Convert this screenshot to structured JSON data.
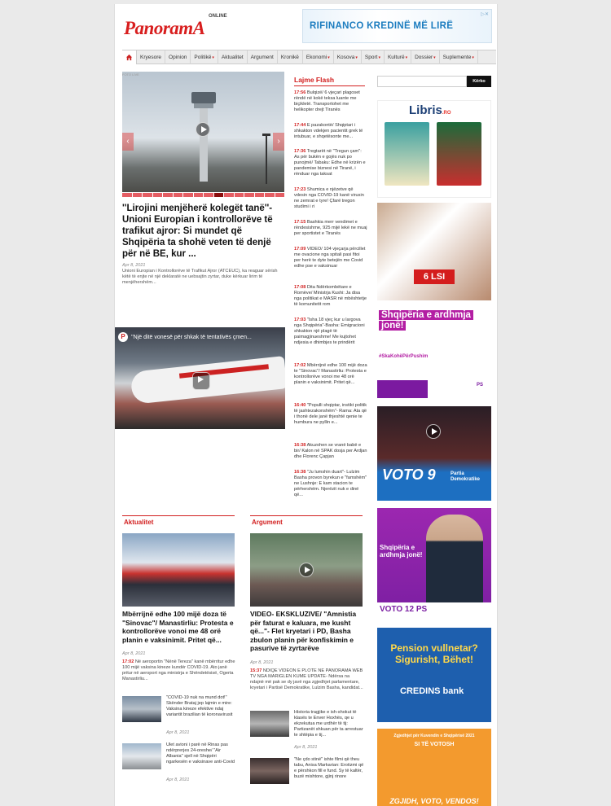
{
  "header": {
    "logo_text": "PanoramA",
    "logo_sub": "ONLINE",
    "ad_text": "RIFINANCO KREDINË MË LIRË"
  },
  "nav": {
    "items": [
      "Kryesore",
      "Opinion",
      "Politikë",
      "Aktualitet",
      "Argument",
      "Kronikë",
      "Ekonomi",
      "Kosova",
      "Sport",
      "Kulturë",
      "Dossier",
      "Suplemente"
    ]
  },
  "main": {
    "slider_tag": "FOTO LIVE",
    "headline": "''Lirojini menjëherë kolegët tanë''- Unioni Europian i kontrollorëve të trafikut ajror: Si mundet që Shqipëria ta shohë veten të denjë për në BE, kur ...",
    "date": "Apr 8, 2021",
    "lede": "Unioni Europian i Kontrollorëve të Trafikut Ajror (ATCEUC), ka reaguar sërish këtë të enjte në një deklaratë ne uebsajtin zyrtar, duke kërkuar lirim të menjëhershëm...",
    "video_title": "''Një ditë vonesë për shkak të tentativës çmen..."
  },
  "flash": {
    "title": "Lajme Flash",
    "items": [
      {
        "time": "17:56",
        "text": "Bulqizë/ 6 vjeçari plagoset rëndë në kokë teksa luante me biçikletë. Transportohet me helikopter drejt Tiranës"
      },
      {
        "time": "17:44",
        "text": "E pazakontë/ Shqiptari i shkakton vdekjen pacientit grek të intubuar, e shqetësonte me..."
      },
      {
        "time": "17:36",
        "text": "Tregtarët në \"Tregun çam\": As për bukën e gojës nuk po punojmë/ Tabaku: Edhe në krizën e pandemise biznesi në Tiranë, i rënduar nga taksat"
      },
      {
        "time": "17:23",
        "text": "Shumica e njëzetve që vdesin nga COVID-19 kanë virusin ne zemrat e tyre! Çfarë tregon studimi i ri"
      },
      {
        "time": "17:15",
        "text": "Bashkia merr vendimet e rëndesishme, 925 mijë lekë ne muaj per sportistet e Tiranës"
      },
      {
        "time": "17:09",
        "text": "VIDEO/ 104 vjeçarja përcillet me ovacione nga spitali pasi fitoi per herë te dyte betejën me Covid edhe pse e vaksinuar"
      },
      {
        "time": "17:08",
        "text": "Dita Ndërkombëtare e Romëve/ Ministrja Kushi: Ja disa nga politikat e MASR në mbështetje të komunitetit rom"
      },
      {
        "time": "17:03",
        "text": "\"Isha 18 vjeç kur u largova nga Shqipëria\"-Basha: Emigracioni shkakton një plagë të paimagjinueshme! Me kujtohet ndjesia e dhimbjes te prindërit"
      },
      {
        "time": "17:02",
        "text": "Mbërrijnë edhe 100 mijë doza te \"Sinovac\"/ Manastirliu: Protesta e kontrollorëve vonoi me 48 orë planin e vaksinimit. Pritet që..."
      },
      {
        "time": "16:40",
        "text": "\"Populli shqiptar, instikt politik të jashtezakonshëm\"- Rama: Ata që i thonë dele janë thjeshtë qenie te humbura ne pyllin e..."
      },
      {
        "time": "16:38",
        "text": "Akuzohen se vranë babë e bir/ Kalon në SPAK dosja per Ardjan dhe Florenc Çapjan"
      },
      {
        "time": "16:38",
        "text": "\"Ju lumshin duart\"- Lulzim Basha provon byrekun e \"famshëm\" ne Lushnje: E kam stacion te përhershëm. Njerëzit nuk e dinë që..."
      }
    ]
  },
  "sidebar": {
    "search_button": "Kërko",
    "ad1_brand": "Libris",
    "ad1_tld": ".RO",
    "ad2_text": "6 LSI",
    "ad3_title": "Shqipëria e ardhmja jonë!",
    "ad3_tag": "#SkaKohëPërPushim",
    "ad3_logo": "PS",
    "ad4_text": "VOTO 9",
    "ad4_party": "Partia Demokratike",
    "ad5_title": "Shqipëria e ardhmja jonë!",
    "ad5_footer": "VOTO 12 PS",
    "ad6_title": "Pension vullnetar? Sigurisht, Bëhet!",
    "ad6_bank": "CREDINS bank",
    "ad7_head": "Zgjedhjet për Kuvendin e Shqipërisë 2021",
    "ad7_title": "SI TË VOTOSH",
    "ad7_footer": "ZGJIDH, VOTO, VENDOS!"
  },
  "aktualitet": {
    "label": "Aktualitet",
    "headline": "Mbërrijnë edhe 100 mijë doza të \"Sinovac\"/ Manastirliu: Protesta e kontrollorëve vonoi me 48 orë planin e vaksinimit. Pritet që...",
    "date": "Apr 8, 2021",
    "time": "17:02",
    "text": "Në aeroportin \"Nënë Tereza\" kanë mbërritur edhe 100 mijë vaksina kineze kundër COVID-19. Ato janë pritur në aeroport nga ministrja e Shëndetësisë, Ogerta Manastirliu...",
    "items": [
      {
        "text": "\"COVID-19 nuk na mund dot!\" Skënder Brataj jep lajmin e mire: Vaksina kineze efektive ndaj variantit brazilian të koronavirusit",
        "date": "Apr 8, 2021"
      },
      {
        "text": "Ulet avioni i parë në Rinas pas ndërprerjes 24-oreshe/ \"Air Albania\" sjell në Shqipëri ngarkesën e vaksinave anti-Covid",
        "date": "Apr 8, 2021"
      }
    ]
  },
  "argument": {
    "label": "Argument",
    "headline": "VIDEO- EKSKLUZIVE/ \"Amnistia për faturat e kaluara, me kusht që...\"- Flet kryetari i PD, Basha zbulon planin për konfiskimin e pasurive të zyrtarëve",
    "date": "Apr 8, 2021",
    "time": "15:37",
    "text": "NDIQE VIDEON E PLOTE NE PANORAMA WEB TV NGA MARIGLEN KUME UPDATE- Ndërsa na ndajnë më pak se dy javë nga zgjedhjet parlamentare, kryetari i Partisë Demokratike, Lulzim Basha, kandidat...",
    "items": [
      {
        "text": "Historia tragjike e ish-shokut të klasës te Enver Hoxhës, qe u ekzekutua me urdhër të tij: Partizanët shkuan për ta arrestuar te shtëpia e tij...",
        "date": "Apr 8, 2021"
      },
      {
        "text": "\"Ne çdo stinë\" ishte filmi që theu tabu, Anisa Markarian: Erotizmi që e përshkon fill e fund. Sy të kaltër, buzë mishtore, gjinj rinore",
        "date": ""
      }
    ]
  }
}
